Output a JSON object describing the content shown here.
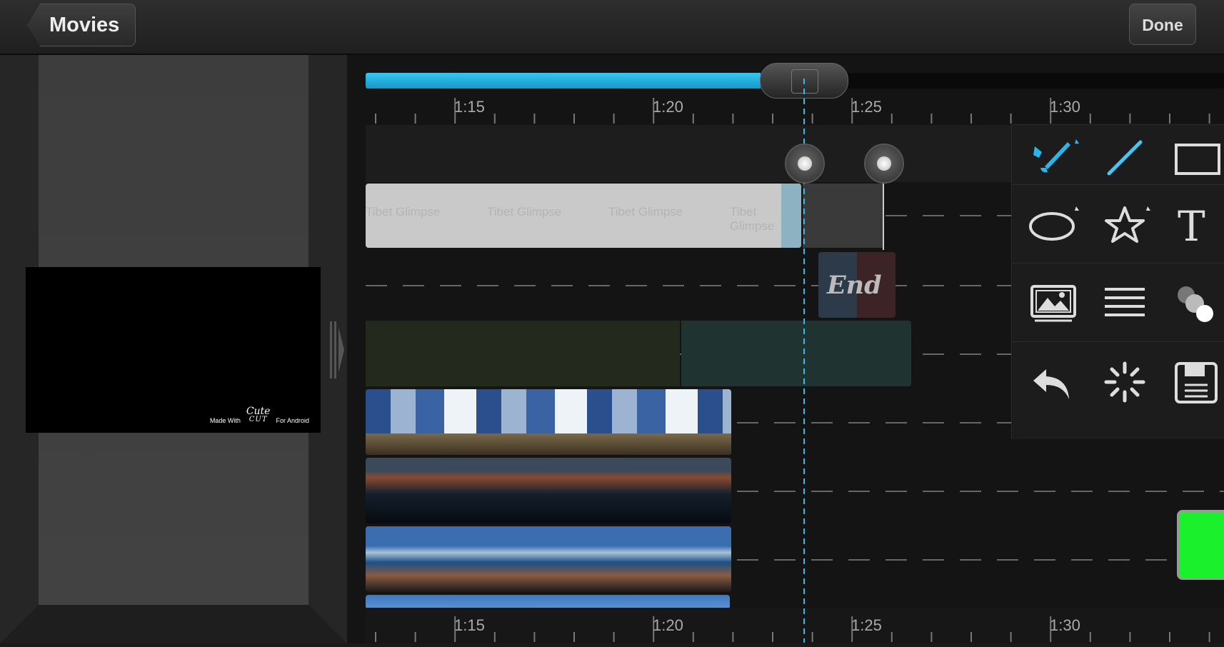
{
  "topbar": {
    "back_label": "Movies",
    "done_label": "Done"
  },
  "preview": {
    "watermark_made_with": "Made With",
    "watermark_brand_script": "Cute",
    "watermark_brand_caps": "CUT",
    "watermark_platform": "For Android"
  },
  "timeline": {
    "progress_fraction": 0.46,
    "ruler_labels": [
      "1:15",
      "1:20",
      "1:25",
      "1:30"
    ],
    "text_clip_label": "Tibet Glimpse",
    "end_clip_label": "End"
  },
  "tools": [
    {
      "name": "brush-tool"
    },
    {
      "name": "line-tool"
    },
    {
      "name": "rectangle-tool"
    },
    {
      "name": "ellipse-tool"
    },
    {
      "name": "star-tool"
    },
    {
      "name": "text-tool"
    },
    {
      "name": "image-tool"
    },
    {
      "name": "lines-tool"
    },
    {
      "name": "bubbles-tool"
    },
    {
      "name": "undo-tool"
    },
    {
      "name": "effect-tool"
    },
    {
      "name": "save-tool"
    }
  ],
  "colors": {
    "accent": "#1ea6d8",
    "selected_color": "#1bf02c"
  }
}
